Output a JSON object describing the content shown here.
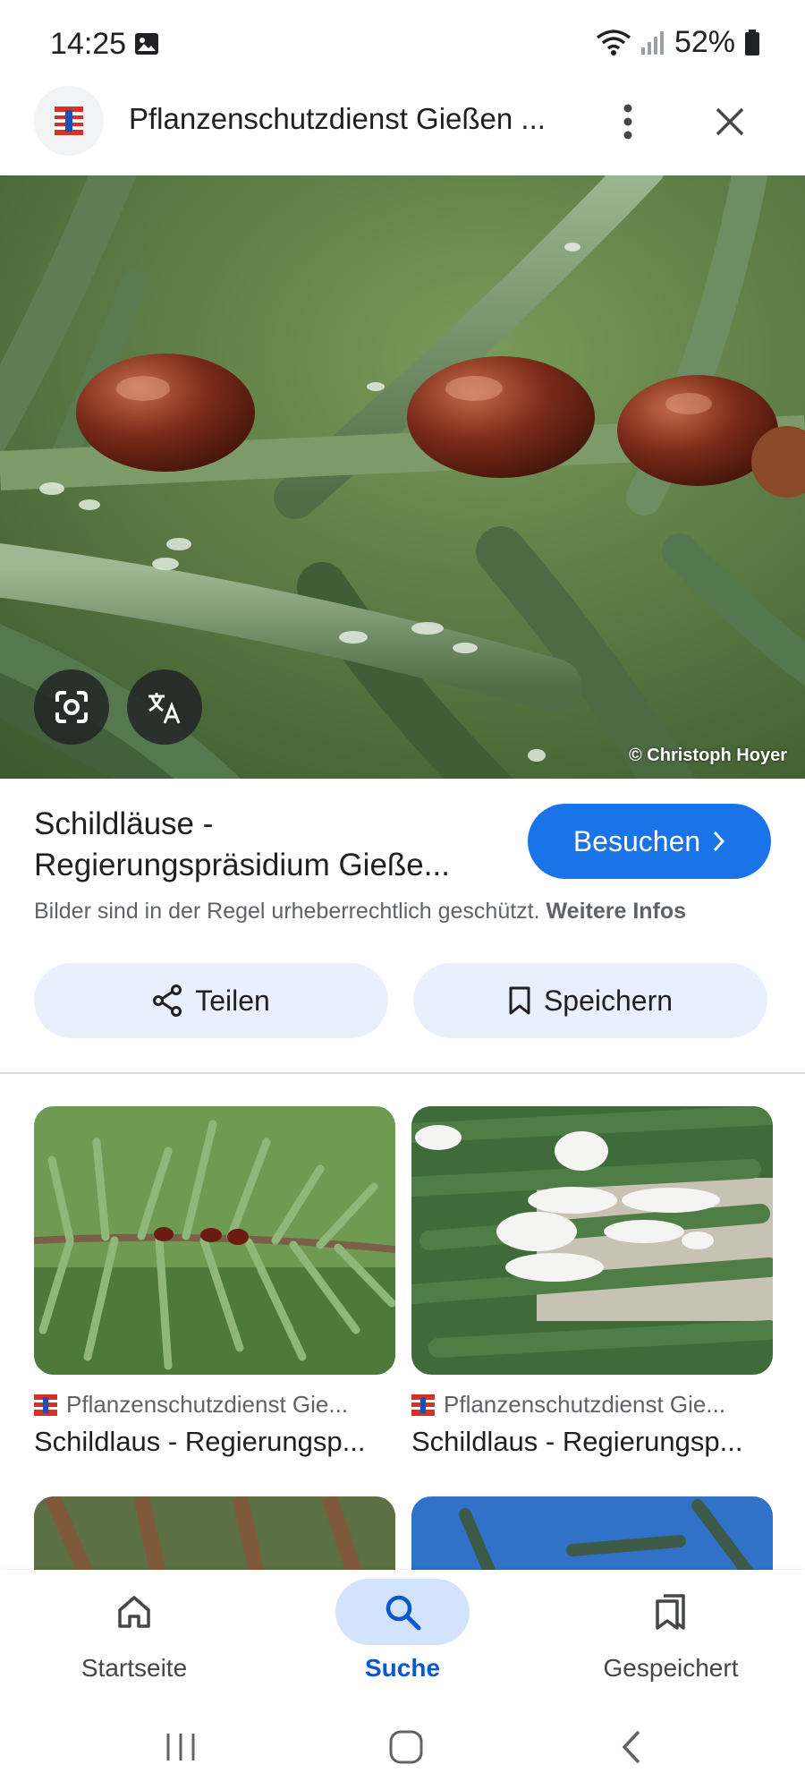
{
  "status_bar": {
    "time": "14:25",
    "battery": "52%"
  },
  "header": {
    "title": "Pflanzenschutzdienst Gießen ..."
  },
  "hero": {
    "credit": "© Christoph Hoyer"
  },
  "result": {
    "title_line1": "Schildläuse -",
    "title_line2": "Regierungspräsidium Gieße...",
    "visit_label": "Besuchen",
    "copyright_text": "Bilder sind in der Regel urheberrechtlich geschützt.",
    "more_info_label": "Weitere Infos"
  },
  "actions": {
    "share_label": "Teilen",
    "save_label": "Speichern"
  },
  "related": [
    {
      "source": "Pflanzenschutzdienst Gie...",
      "title": "Schildlaus - Regierungsp..."
    },
    {
      "source": "Pflanzenschutzdienst Gie...",
      "title": "Schildlaus - Regierungsp..."
    }
  ],
  "bottom_nav": {
    "items": [
      {
        "label": "Startseite",
        "icon": "home-icon",
        "active": false
      },
      {
        "label": "Suche",
        "icon": "search-icon",
        "active": true
      },
      {
        "label": "Gespeichert",
        "icon": "saved-icon",
        "active": false
      }
    ]
  },
  "colors": {
    "accent": "#1a73e8",
    "tonal_button": "#e8f0fe",
    "active_nav": "#0b57d0"
  }
}
